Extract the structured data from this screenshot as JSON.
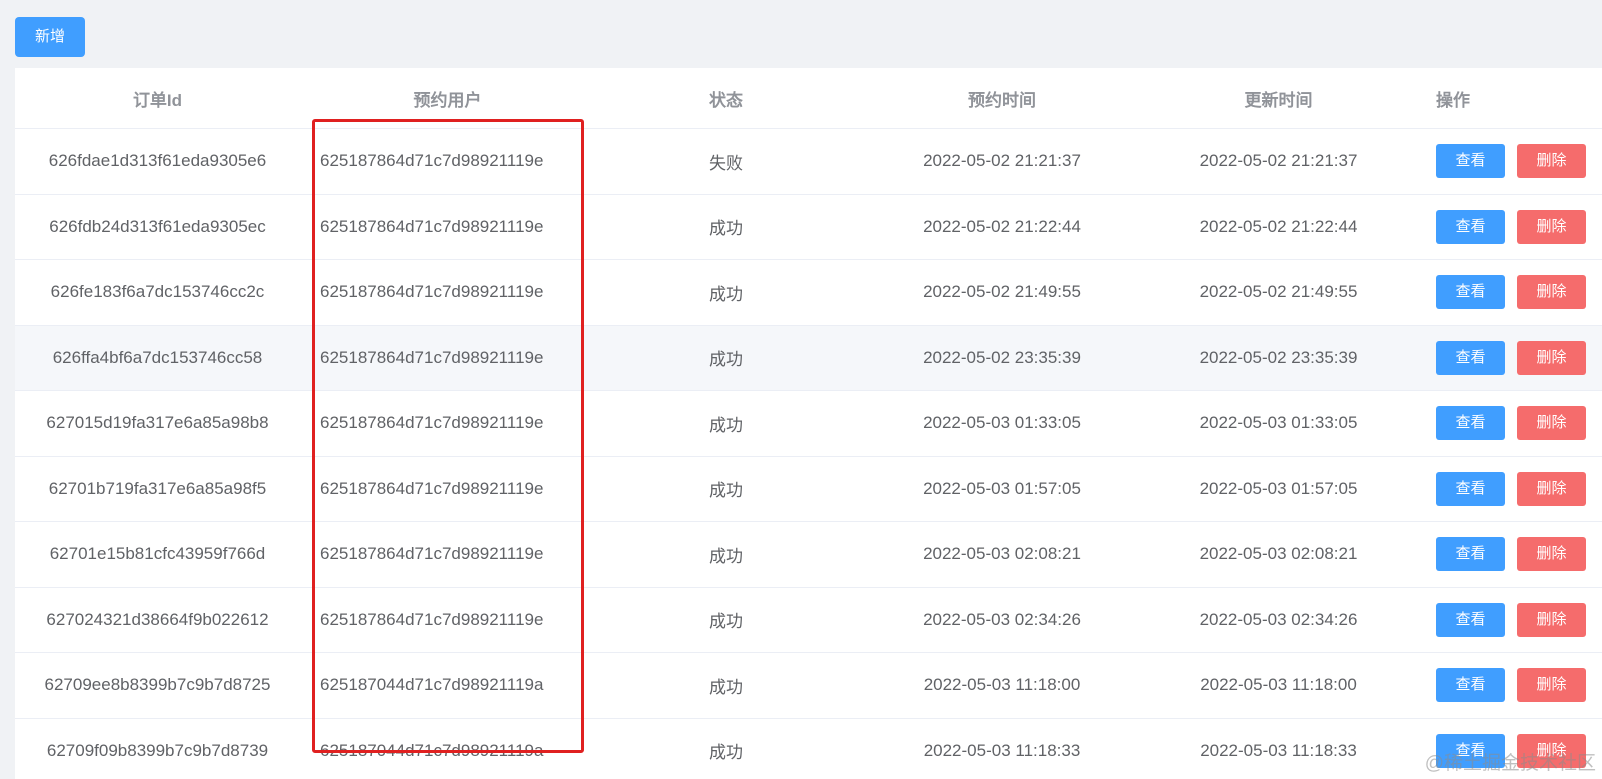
{
  "toolbar": {
    "add_label": "新增"
  },
  "table": {
    "headers": {
      "order_id": "订单Id",
      "user": "预约用户",
      "status": "状态",
      "booking_time": "预约时间",
      "update_time": "更新时间",
      "actions": "操作"
    },
    "action_labels": {
      "view": "查看",
      "delete": "删除"
    },
    "rows": [
      {
        "order_id": "626fdae1d313f61eda9305e6",
        "user": "625187864d71c7d98921119e",
        "status": "失败",
        "booking_time": "2022-05-02 21:21:37",
        "update_time": "2022-05-02 21:21:37"
      },
      {
        "order_id": "626fdb24d313f61eda9305ec",
        "user": "625187864d71c7d98921119e",
        "status": "成功",
        "booking_time": "2022-05-02 21:22:44",
        "update_time": "2022-05-02 21:22:44"
      },
      {
        "order_id": "626fe183f6a7dc153746cc2c",
        "user": "625187864d71c7d98921119e",
        "status": "成功",
        "booking_time": "2022-05-02 21:49:55",
        "update_time": "2022-05-02 21:49:55"
      },
      {
        "order_id": "626ffa4bf6a7dc153746cc58",
        "user": "625187864d71c7d98921119e",
        "status": "成功",
        "booking_time": "2022-05-02 23:35:39",
        "update_time": "2022-05-02 23:35:39"
      },
      {
        "order_id": "627015d19fa317e6a85a98b8",
        "user": "625187864d71c7d98921119e",
        "status": "成功",
        "booking_time": "2022-05-03 01:33:05",
        "update_time": "2022-05-03 01:33:05"
      },
      {
        "order_id": "62701b719fa317e6a85a98f5",
        "user": "625187864d71c7d98921119e",
        "status": "成功",
        "booking_time": "2022-05-03 01:57:05",
        "update_time": "2022-05-03 01:57:05"
      },
      {
        "order_id": "62701e15b81cfc43959f766d",
        "user": "625187864d71c7d98921119e",
        "status": "成功",
        "booking_time": "2022-05-03 02:08:21",
        "update_time": "2022-05-03 02:08:21"
      },
      {
        "order_id": "627024321d38664f9b022612",
        "user": "625187864d71c7d98921119e",
        "status": "成功",
        "booking_time": "2022-05-03 02:34:26",
        "update_time": "2022-05-03 02:34:26"
      },
      {
        "order_id": "62709ee8b8399b7c9b7d8725",
        "user": "625187044d71c7d98921119a",
        "status": "成功",
        "booking_time": "2022-05-03 11:18:00",
        "update_time": "2022-05-03 11:18:00"
      },
      {
        "order_id": "62709f09b8399b7c9b7d8739",
        "user": "625187044d71c7d98921119a",
        "status": "成功",
        "booking_time": "2022-05-03 11:18:33",
        "update_time": "2022-05-03 11:18:33"
      }
    ]
  },
  "watermark": "@稀土掘金技术社区",
  "colors": {
    "primary": "#409eff",
    "danger": "#f56c6c",
    "highlight": "#e02020"
  }
}
